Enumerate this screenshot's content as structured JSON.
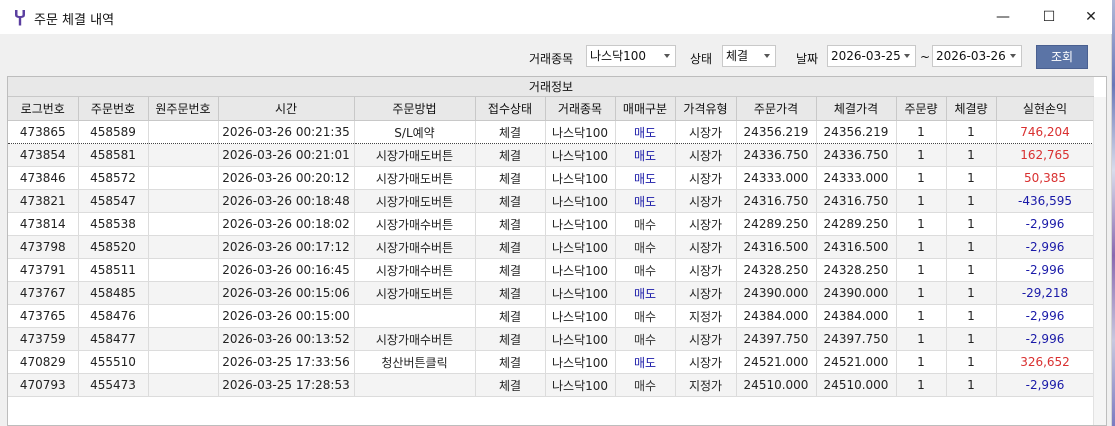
{
  "window": {
    "title": "주문 체결 내역",
    "minimize_symbol": "—",
    "maximize_symbol": "☐",
    "close_symbol": "✕"
  },
  "filters": {
    "symbol_label": "거래종목",
    "symbol_value": "나스닥100",
    "status_label": "상태",
    "status_value": "체결",
    "date_label": "날짜",
    "date_from": "2026-03-25",
    "date_sep": "~",
    "date_to": "2026-03-26",
    "search_label": "조회"
  },
  "table": {
    "group_header": "거래정보",
    "columns": [
      "로그번호",
      "주문번호",
      "원주문번호",
      "시간",
      "주문방법",
      "접수상태",
      "거래종목",
      "매매구분",
      "가격유형",
      "주문가격",
      "체결가격",
      "주문량",
      "체결량",
      "실현손익"
    ],
    "rows": [
      [
        "473865",
        "458589",
        "",
        "2026-03-26 00:21:35",
        "S/L예약",
        "체결",
        "나스닥100",
        "매도",
        "시장가",
        "24356.219",
        "24356.219",
        "1",
        "1",
        "746,204"
      ],
      [
        "473854",
        "458581",
        "",
        "2026-03-26 00:21:01",
        "시장가매도버튼",
        "체결",
        "나스닥100",
        "매도",
        "시장가",
        "24336.750",
        "24336.750",
        "1",
        "1",
        "162,765"
      ],
      [
        "473846",
        "458572",
        "",
        "2026-03-26 00:20:12",
        "시장가매도버튼",
        "체결",
        "나스닥100",
        "매도",
        "시장가",
        "24333.000",
        "24333.000",
        "1",
        "1",
        "50,385"
      ],
      [
        "473821",
        "458547",
        "",
        "2026-03-26 00:18:48",
        "시장가매도버튼",
        "체결",
        "나스닥100",
        "매도",
        "시장가",
        "24316.750",
        "24316.750",
        "1",
        "1",
        "-436,595"
      ],
      [
        "473814",
        "458538",
        "",
        "2026-03-26 00:18:02",
        "시장가매수버튼",
        "체결",
        "나스닥100",
        "매수",
        "시장가",
        "24289.250",
        "24289.250",
        "1",
        "1",
        "-2,996"
      ],
      [
        "473798",
        "458520",
        "",
        "2026-03-26 00:17:12",
        "시장가매수버튼",
        "체결",
        "나스닥100",
        "매수",
        "시장가",
        "24316.500",
        "24316.500",
        "1",
        "1",
        "-2,996"
      ],
      [
        "473791",
        "458511",
        "",
        "2026-03-26 00:16:45",
        "시장가매수버튼",
        "체결",
        "나스닥100",
        "매수",
        "시장가",
        "24328.250",
        "24328.250",
        "1",
        "1",
        "-2,996"
      ],
      [
        "473767",
        "458485",
        "",
        "2026-03-26 00:15:06",
        "시장가매도버튼",
        "체결",
        "나스닥100",
        "매도",
        "시장가",
        "24390.000",
        "24390.000",
        "1",
        "1",
        "-29,218"
      ],
      [
        "473765",
        "458476",
        "",
        "2026-03-26 00:15:00",
        "",
        "체결",
        "나스닥100",
        "매수",
        "지정가",
        "24384.000",
        "24384.000",
        "1",
        "1",
        "-2,996"
      ],
      [
        "473759",
        "458477",
        "",
        "2026-03-26 00:13:52",
        "시장가매수버튼",
        "체결",
        "나스닥100",
        "매수",
        "시장가",
        "24397.750",
        "24397.750",
        "1",
        "1",
        "-2,996"
      ],
      [
        "470829",
        "455510",
        "",
        "2026-03-25 17:33:56",
        "청산버튼클릭",
        "체결",
        "나스닥100",
        "매도",
        "시장가",
        "24521.000",
        "24521.000",
        "1",
        "1",
        "326,652"
      ],
      [
        "470793",
        "455473",
        "",
        "2026-03-25 17:28:53",
        "",
        "체결",
        "나스닥100",
        "매수",
        "지정가",
        "24510.000",
        "24510.000",
        "1",
        "1",
        "-2,996"
      ]
    ]
  },
  "colors": {
    "sell": "#1a1aa8",
    "buy": "#333333",
    "profit": "#d93030",
    "loss": "#1a1aa8",
    "accent": "#5b74a6"
  },
  "icons": {
    "app": "tuning-fork-icon"
  }
}
